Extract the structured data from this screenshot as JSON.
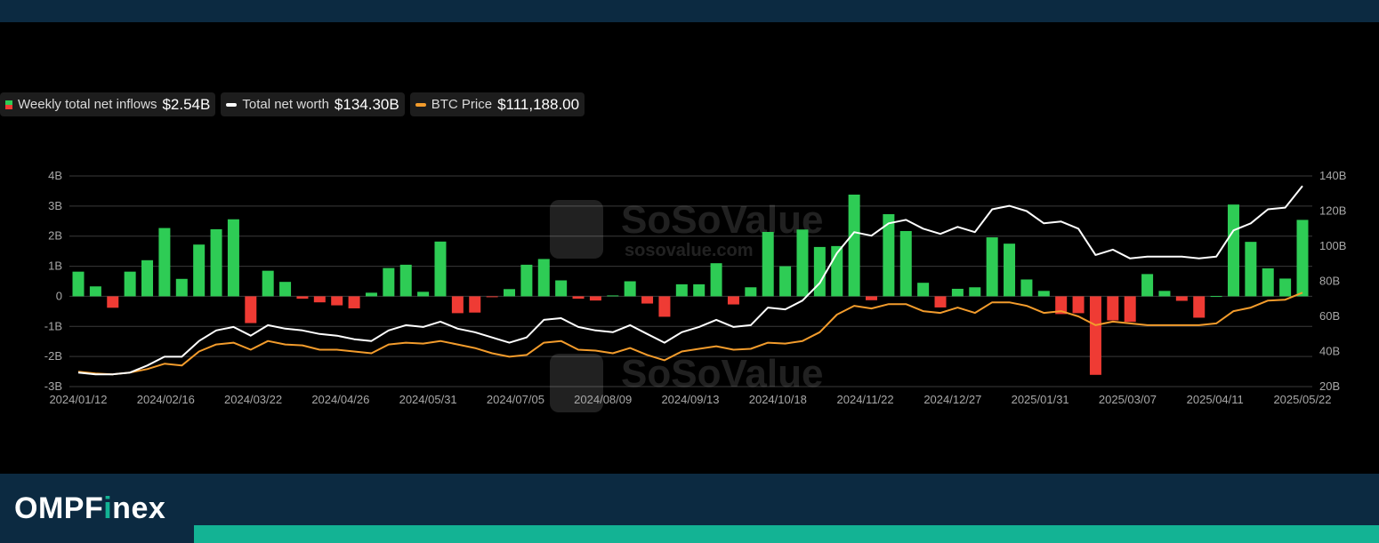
{
  "legend": {
    "inflows": {
      "label": "Weekly total net inflows",
      "value": "$2.54B"
    },
    "networth": {
      "label": "Total net worth",
      "value": "$134.30B"
    },
    "btc": {
      "label": "BTC Price",
      "value": "$111,188.00"
    }
  },
  "watermark": {
    "brand": "SoSoValue",
    "url": "sosovalue.com"
  },
  "brand": {
    "name_prefix": "OMPF",
    "name_accent": "i",
    "name_suffix": "nex"
  },
  "colors": {
    "positive": "#2ecc55",
    "negative": "#ef3b34",
    "networth": "#ffffff",
    "btc": "#f39c2c",
    "band": "#0c2a41",
    "accent": "#13b394"
  },
  "chart_data": {
    "type": "bar",
    "x_tick_labels": [
      "2024/01/12",
      "2024/02/16",
      "2024/03/22",
      "2024/04/26",
      "2024/05/31",
      "2024/07/05",
      "2024/08/09",
      "2024/09/13",
      "2024/10/18",
      "2024/11/22",
      "2024/12/27",
      "2025/01/31",
      "2025/03/07",
      "2025/04/11",
      "2025/05/22"
    ],
    "y_left_ticks": [
      "4B",
      "3B",
      "2B",
      "1B",
      "0",
      "-1B",
      "-2B",
      "-3B"
    ],
    "y_left_range": [
      -3,
      4
    ],
    "y_right_ticks": [
      "140B",
      "120B",
      "100B",
      "80B",
      "60B",
      "40B",
      "20B"
    ],
    "y_right_range": [
      20,
      140
    ],
    "grid": true,
    "legend_position": "top-left",
    "series": [
      {
        "name": "Weekly total net inflows",
        "type": "bar",
        "unit": "B",
        "values": [
          0.82,
          0.33,
          -0.38,
          0.82,
          1.2,
          2.27,
          0.58,
          1.72,
          2.23,
          2.56,
          -0.89,
          0.85,
          0.48,
          -0.08,
          -0.2,
          -0.3,
          -0.4,
          0.12,
          0.94,
          1.05,
          0.15,
          1.82,
          -0.56,
          -0.54,
          -0.02,
          0.24,
          1.05,
          1.24,
          0.53,
          -0.08,
          -0.14,
          0.03,
          0.5,
          -0.24,
          -0.68,
          0.4,
          0.4,
          1.1,
          -0.27,
          0.3,
          2.14,
          1.0,
          2.22,
          1.64,
          1.67,
          3.38,
          -0.13,
          2.73,
          2.17,
          0.45,
          -0.37,
          0.25,
          0.3,
          1.96,
          1.75,
          0.56,
          0.18,
          -0.59,
          -0.56,
          -2.61,
          -0.8,
          -0.85,
          0.74,
          0.18,
          -0.15,
          -0.71,
          0.01,
          3.05,
          1.81,
          0.93,
          0.59,
          2.54
        ]
      },
      {
        "name": "Total net worth",
        "type": "line",
        "axis": "right",
        "unit": "B",
        "values": [
          28,
          27,
          27,
          28,
          32,
          37,
          37,
          46,
          52,
          54,
          49,
          55,
          53,
          52,
          50,
          49,
          47,
          46,
          52,
          55,
          54,
          57,
          53,
          51,
          48,
          45,
          48,
          58,
          59,
          54,
          52,
          51,
          55,
          50,
          45,
          51,
          54,
          58,
          54,
          55,
          65,
          64,
          69,
          79,
          96,
          108,
          106,
          113,
          115,
          110,
          107,
          111,
          108,
          121,
          123,
          120,
          113,
          114,
          110,
          95,
          98,
          93,
          94,
          94,
          94,
          93,
          94,
          109,
          113,
          121,
          122,
          134.3
        ]
      },
      {
        "name": "BTC Price",
        "type": "line",
        "axis": "right",
        "unit": "B",
        "values": [
          28.5,
          27.5,
          27,
          28,
          30,
          33,
          32,
          40,
          44,
          45,
          41,
          46,
          44,
          43.5,
          41,
          41,
          40,
          39,
          44,
          45,
          44.5,
          46,
          44,
          42,
          39,
          37,
          38,
          45,
          46,
          41,
          40.5,
          39,
          42,
          38,
          35,
          40,
          41.5,
          43,
          41,
          41.5,
          45,
          44.5,
          46,
          51,
          61,
          66,
          64.5,
          67,
          67,
          63,
          62,
          65,
          62,
          68,
          68,
          66,
          62,
          63,
          60,
          55,
          57,
          56,
          55,
          55,
          55,
          55,
          56,
          63,
          65,
          69,
          69.5,
          73.5
        ]
      }
    ]
  }
}
